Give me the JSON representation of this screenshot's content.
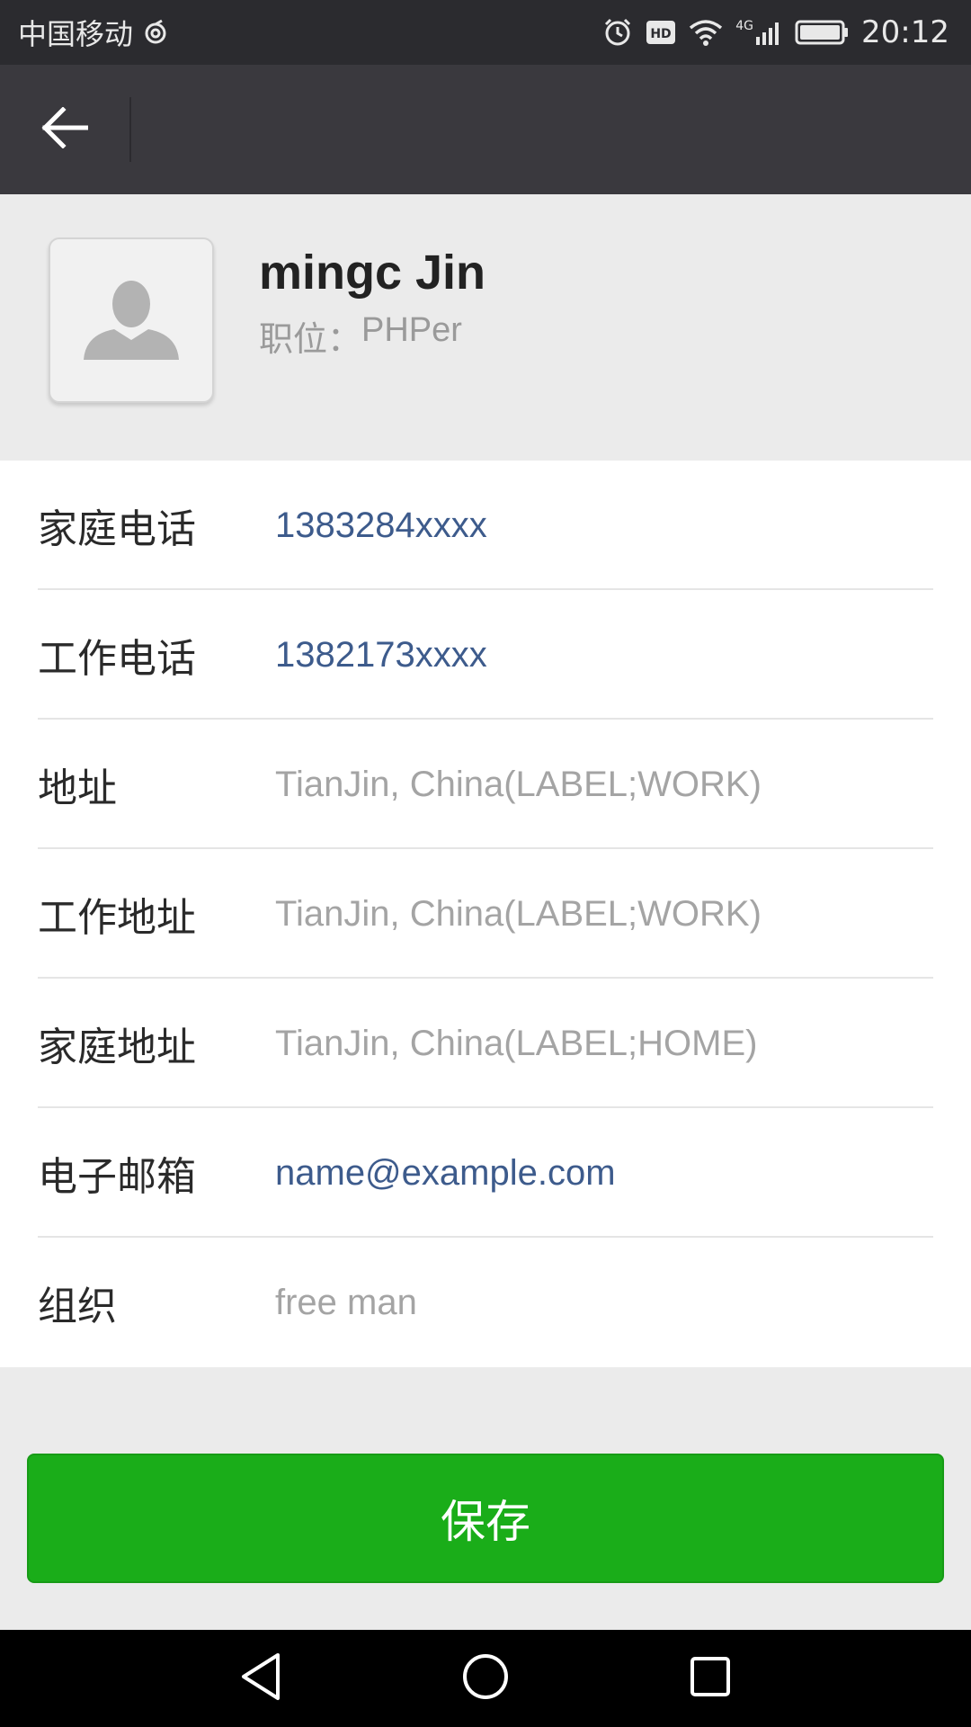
{
  "status_bar": {
    "carrier": "中国移动",
    "network": "4G",
    "time": "20:12"
  },
  "icons": {
    "back": "arrow-left-icon",
    "avatar": "person-silhouette-icon"
  },
  "profile": {
    "name": "mingc Jin",
    "title_label": "职位：",
    "title_value": "PHPer"
  },
  "fields": [
    {
      "label": "家庭电话",
      "value": "1383284xxxx",
      "style": "link"
    },
    {
      "label": "工作电话",
      "value": "1382173xxxx",
      "style": "link"
    },
    {
      "label": "地址",
      "value": "TianJin, China(LABEL;WORK)",
      "style": "plain"
    },
    {
      "label": "工作地址",
      "value": "TianJin, China(LABEL;WORK)",
      "style": "plain"
    },
    {
      "label": "家庭地址",
      "value": "TianJin, China(LABEL;HOME)",
      "style": "plain"
    },
    {
      "label": "电子邮箱",
      "value": "name@example.com",
      "style": "link"
    },
    {
      "label": "组织",
      "value": "free man",
      "style": "plain"
    }
  ],
  "actions": {
    "save_label": "保存"
  },
  "colors": {
    "topbar": "#3a393e",
    "link": "#3d5b8c",
    "save": "#1aad19"
  }
}
